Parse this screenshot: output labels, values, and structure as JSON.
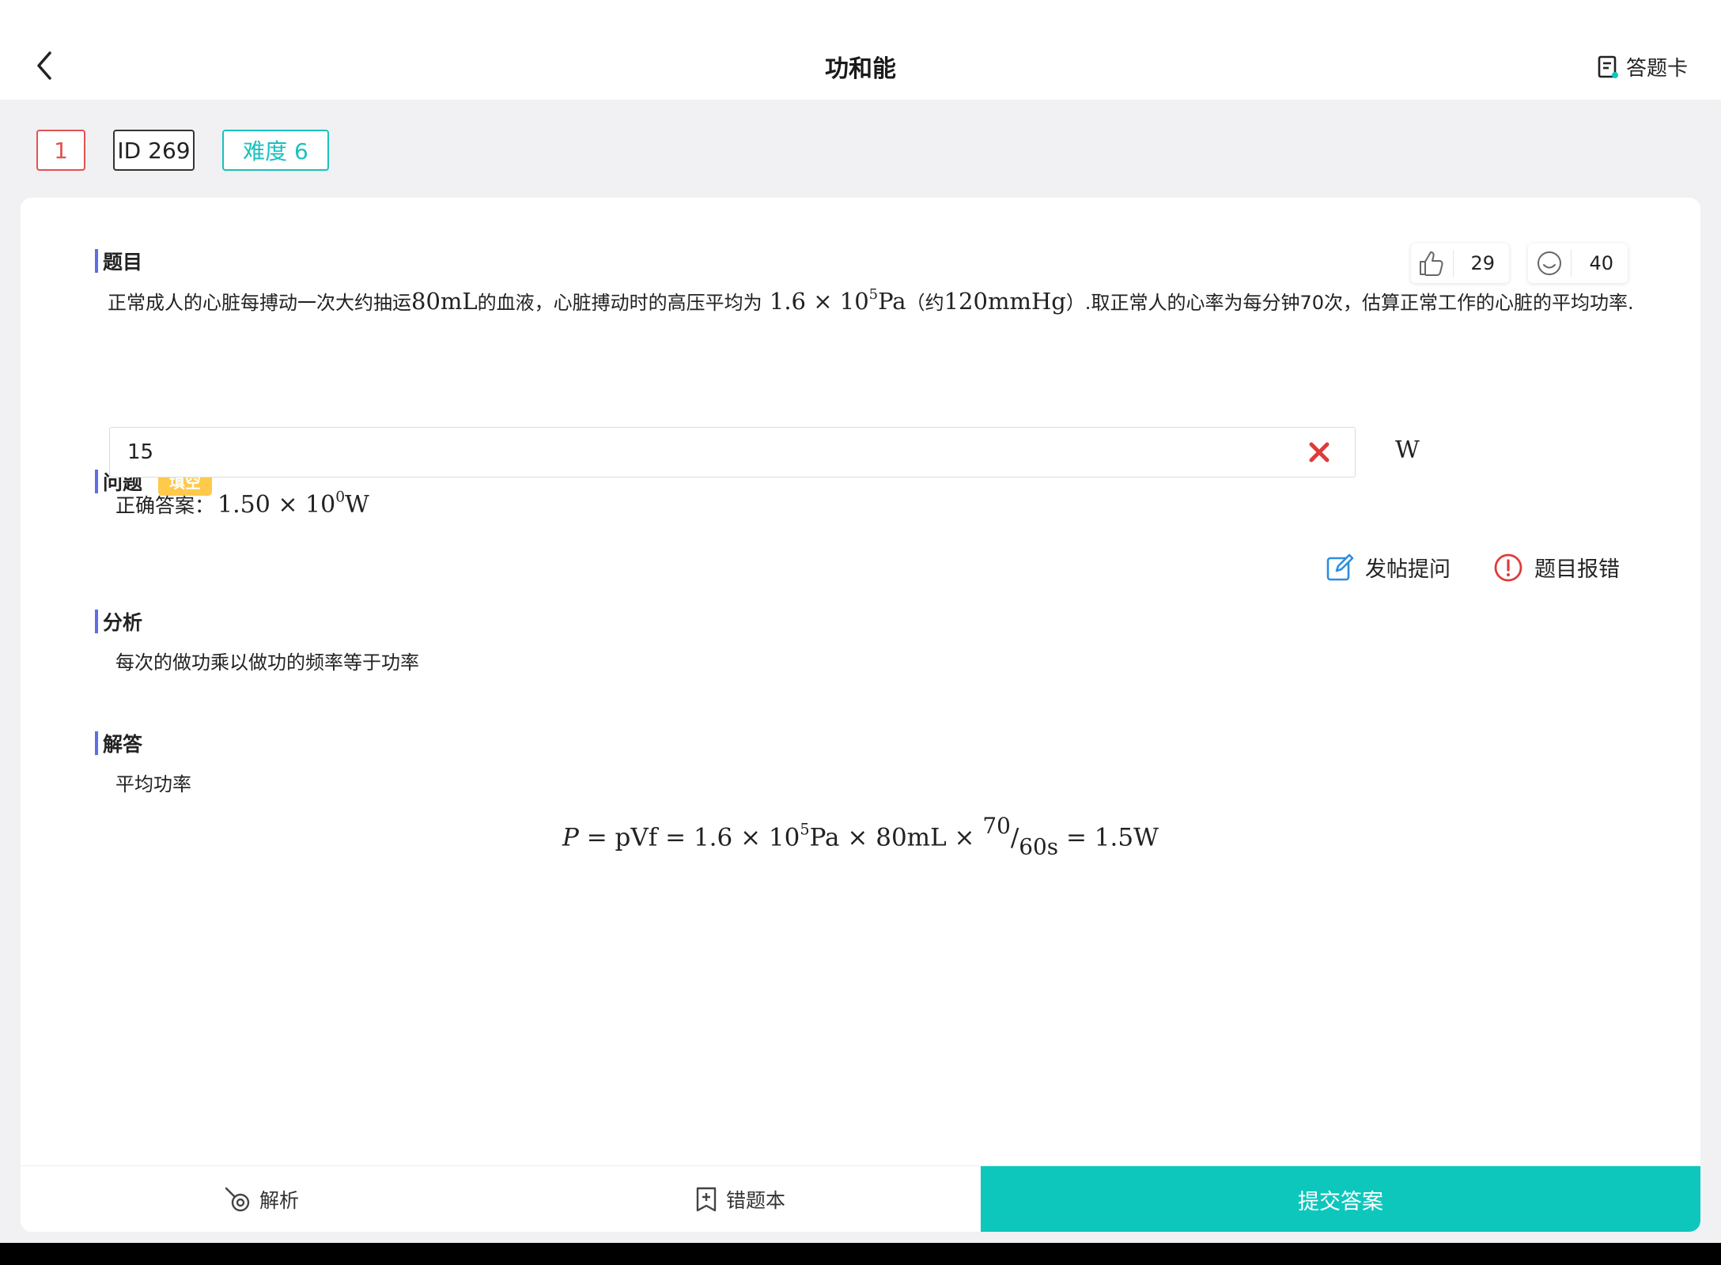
{
  "header": {
    "title": "功和能",
    "answer_card_label": "答题卡"
  },
  "tags": {
    "number": "1",
    "id": "ID 269",
    "difficulty": "难度 6"
  },
  "question": {
    "section_label": "题目",
    "likes": "29",
    "reactions": "40",
    "text_part1": "正常成人的心脏每搏动一次大约抽运",
    "text_80mL": "80mL",
    "text_part2": "的血液，心脏搏动时的高压平均为",
    "text_pressure_base": "1.6 × 10",
    "text_pressure_exp": "5",
    "text_pressure_unit": "Pa",
    "text_part3": "（约",
    "text_mmhg": "120mmHg",
    "text_part4": "）.取正常人的心率为每分钟70次，估算正常工作的心脏的平均功率."
  },
  "problem": {
    "section_label": "问题",
    "type_badge": "填空",
    "input_value": "15",
    "unit": "W",
    "correct_label": "正确答案：",
    "correct_base": "1.50 × 10",
    "correct_exp": "0",
    "correct_unit": "W"
  },
  "actions": {
    "post_question": "发帖提问",
    "report_error": "题目报错"
  },
  "analysis": {
    "section_label": "分析",
    "text": "每次的做功乘以做功的频率等于功率"
  },
  "solution": {
    "section_label": "解答",
    "intro": "平均功率",
    "formula_lhs": "P",
    "formula_mid": " = pVf = 1.6 × 10",
    "formula_exp": "5",
    "formula_rest": "Pa × 80mL × ",
    "formula_frac_num": "70",
    "formula_frac_den": "60s",
    "formula_end": " = 1.5W"
  },
  "bottom_bar": {
    "analysis_label": "解析",
    "wrong_book_label": "错题本",
    "submit_label": "提交答案"
  },
  "colors": {
    "accent": "#0dc7bd",
    "tag_red": "#e05252",
    "tag_teal": "#19c1be",
    "section_bar": "#5b6ee8",
    "badge_yellow": "#ffc94a",
    "clear_red": "#e03a3a",
    "icon_blue": "#2d8de0"
  }
}
